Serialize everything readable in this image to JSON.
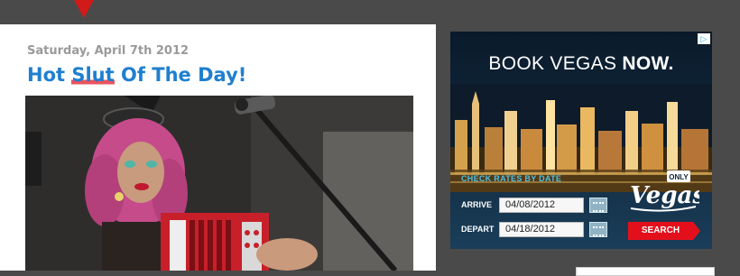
{
  "post": {
    "date": "Saturday, April 7th 2012",
    "title_pre": "Hot ",
    "title_highlight": "Slut",
    "title_post": " Of The Day!"
  },
  "ad": {
    "headline_light": "BOOK VEGAS ",
    "headline_bold": "NOW.",
    "rates_label": "CHECK RATES BY DATE",
    "arrive_label": "ARRIVE",
    "arrive_value": "04/08/2012",
    "depart_label": "DEPART",
    "depart_value": "04/18/2012",
    "logo_top": "ONLY",
    "logo_main": "Vegas",
    "search_label": "SEARCH",
    "choices_icon": "ad-choices-icon"
  },
  "colors": {
    "page_bg": "#4a4a4a",
    "title": "#1f7fcf",
    "highlight": "#e7545f",
    "search_button": "#e3101c",
    "rates_label": "#4ec0e6"
  }
}
